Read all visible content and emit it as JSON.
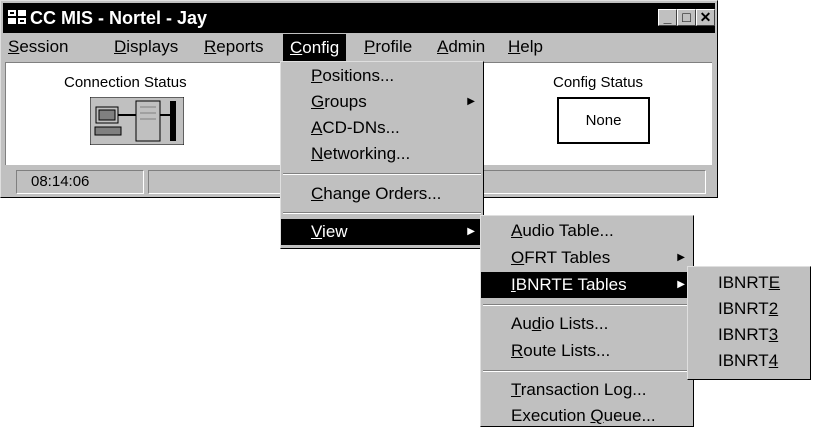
{
  "window": {
    "title": "CC MIS - Nortel - Jay",
    "minimize": "_",
    "maximize": "□",
    "close": "✕"
  },
  "menubar": {
    "session": {
      "pre": "",
      "key": "S",
      "post": "ession"
    },
    "displays": {
      "pre": "",
      "key": "D",
      "post": "isplays"
    },
    "reports": {
      "pre": "",
      "key": "R",
      "post": "eports"
    },
    "config": {
      "pre": "",
      "key": "C",
      "post": "onfig"
    },
    "profile": {
      "pre": "",
      "key": "P",
      "post": "rofile"
    },
    "admin": {
      "pre": "",
      "key": "A",
      "post": "dmin"
    },
    "help": {
      "pre": "",
      "key": "H",
      "post": "elp"
    }
  },
  "panel": {
    "connection_status_label": "Connection Status",
    "config_status_label": "Config Status",
    "config_status_value": "None"
  },
  "statusbar": {
    "time": "08:14:06"
  },
  "config_menu": {
    "positions": {
      "pre": "",
      "key": "P",
      "post": "ositions..."
    },
    "groups": {
      "pre": "",
      "key": "G",
      "post": "roups"
    },
    "acd_dns": {
      "pre": "",
      "key": "A",
      "post": "CD-DNs..."
    },
    "networking": {
      "pre": "",
      "key": "N",
      "post": "etworking..."
    },
    "change_orders": {
      "pre": "",
      "key": "C",
      "post": "hange Orders..."
    },
    "view": {
      "pre": "",
      "key": "V",
      "post": "iew"
    }
  },
  "view_menu": {
    "audio_table": {
      "pre": "",
      "key": "A",
      "post": "udio Table..."
    },
    "ofrt_tables": {
      "pre": "",
      "key": "O",
      "post": "FRT Tables"
    },
    "ibnrte_tables": {
      "pre": "",
      "key": "I",
      "post": "BNRTE Tables"
    },
    "audio_lists": {
      "pre": "Au",
      "key": "d",
      "post": "io Lists..."
    },
    "route_lists": {
      "pre": "",
      "key": "R",
      "post": "oute Lists..."
    },
    "transaction_log": {
      "pre": "",
      "key": "T",
      "post": "ransaction Log..."
    },
    "execution_queue": {
      "pre": "Execution ",
      "key": "Q",
      "post": "ueue..."
    }
  },
  "ibnrte_menu": {
    "ibnrte": {
      "pre": "IBNRT",
      "key": "E",
      "post": ""
    },
    "ibnrt2": {
      "pre": "IBNRT",
      "key": "2",
      "post": ""
    },
    "ibnrt3": {
      "pre": "IBNRT",
      "key": "3",
      "post": ""
    },
    "ibnrt4": {
      "pre": "IBNRT",
      "key": "4",
      "post": ""
    }
  },
  "colors": {
    "face": "#c0c0c0",
    "highlight": "#000000",
    "titlebar": "#000000"
  }
}
